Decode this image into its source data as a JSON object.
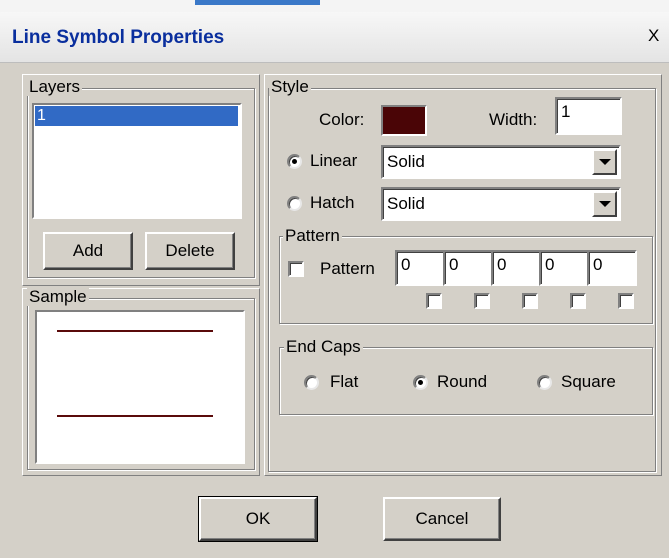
{
  "window": {
    "title": "Line Symbol Properties",
    "close_label": "X"
  },
  "layers": {
    "legend": "Layers",
    "items": [
      "1"
    ],
    "selected_index": 0,
    "add_label": "Add",
    "delete_label": "Delete"
  },
  "sample": {
    "legend": "Sample",
    "line_color": "#5a0a0a"
  },
  "style": {
    "legend": "Style",
    "color_label": "Color:",
    "color_value": "#4a0506",
    "width_label": "Width:",
    "width_value": "1",
    "linear": {
      "label": "Linear",
      "selected": true,
      "value": "Solid"
    },
    "hatch": {
      "label": "Hatch",
      "selected": false,
      "value": "Solid"
    },
    "pattern": {
      "legend": "Pattern",
      "checkbox_label": "Pattern",
      "checked": false,
      "values": [
        "0",
        "0",
        "0",
        "0",
        "0"
      ]
    },
    "end_caps": {
      "legend": "End Caps",
      "options": [
        {
          "label": "Flat",
          "selected": false
        },
        {
          "label": "Round",
          "selected": true
        },
        {
          "label": "Square",
          "selected": false
        }
      ]
    }
  },
  "footer": {
    "ok_label": "OK",
    "cancel_label": "Cancel"
  },
  "colors": {
    "title_text": "#0a2f9e",
    "selection": "#316ac5",
    "dialog_face": "#d4d0c8"
  }
}
